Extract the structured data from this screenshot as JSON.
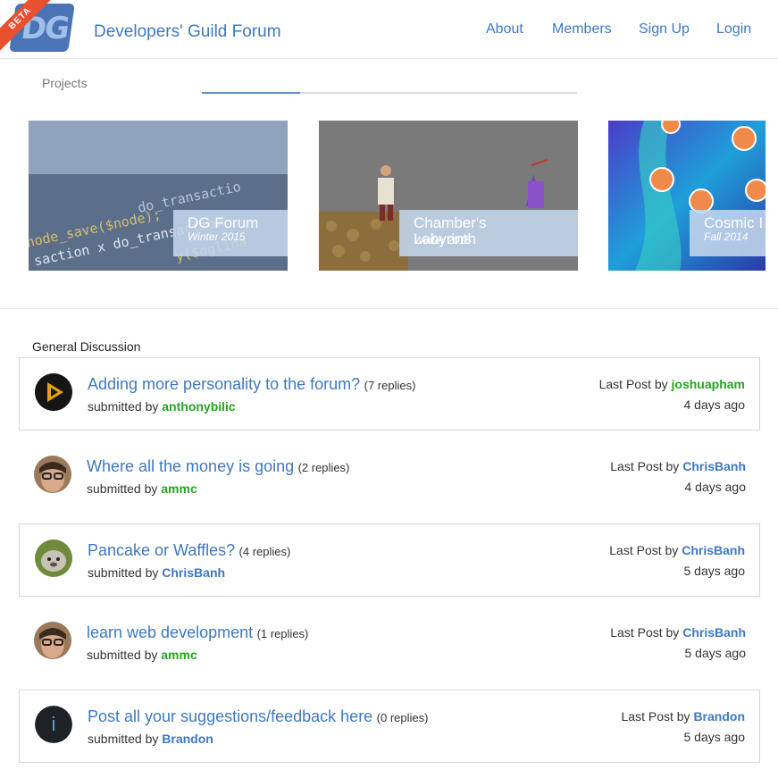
{
  "header": {
    "logo_text": "DG",
    "beta_badge": "BETA",
    "site_title": "Developers' Guild Forum",
    "nav": [
      "About",
      "Members",
      "Sign Up",
      "Login"
    ]
  },
  "projects": {
    "label": "Projects",
    "cards": [
      {
        "title": "DG Forum",
        "date": "Winter 2015"
      },
      {
        "title": "Chamber's Labyrinth",
        "date": "Winter 2015"
      },
      {
        "title": "Cosmic I",
        "date": "Fall 2014"
      }
    ]
  },
  "discussion": {
    "label": "General Discussion",
    "submitted_prefix": "submitted by",
    "last_post_prefix": "Last Post by",
    "posts": [
      {
        "title": "Adding more personality to the forum?",
        "replies": "(7 replies)",
        "author": "anthonybilic",
        "last_by": "joshuapham",
        "ago": "4 days ago"
      },
      {
        "title": "Where all the money is going",
        "replies": "(2 replies)",
        "author": "ammc",
        "last_by": "ChrisBanh",
        "ago": "4 days ago"
      },
      {
        "title": "Pancake or Waffles?",
        "replies": "(4 replies)",
        "author": "ChrisBanh",
        "last_by": "ChrisBanh",
        "ago": "5 days ago"
      },
      {
        "title": "learn web development",
        "replies": "(1 replies)",
        "author": "ammc",
        "last_by": "ChrisBanh",
        "ago": "5 days ago"
      },
      {
        "title": "Post all your suggestions/feedback here",
        "replies": "(0 replies)",
        "author": "Brandon",
        "last_by": "Brandon",
        "ago": "5 days ago"
      }
    ]
  },
  "colors": {
    "link": "#3d78c2",
    "user_green": "#23a51f",
    "beta": "#e8502f"
  }
}
